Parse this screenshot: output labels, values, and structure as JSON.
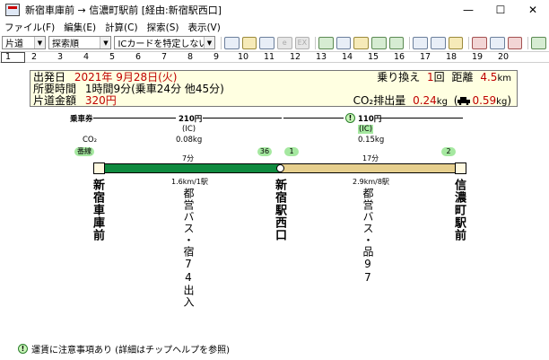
{
  "window": {
    "title": "新宿車庫前 → 信濃町駅前 [経由:新宿駅西口]",
    "minimize": "—",
    "maximize": "☐",
    "close": "✕"
  },
  "menu": [
    "ファイル(F)",
    "編集(E)",
    "計算(C)",
    "探索(S)",
    "表示(V)"
  ],
  "toolbar": {
    "direction_select": "片道",
    "sort_select": "探索順",
    "ic_select": "ICカードを特定しない",
    "disabled_icon_1": "e",
    "disabled_icon_2": "EX"
  },
  "ruler": {
    "numbers": [
      "1",
      "2",
      "3",
      "4",
      "5",
      "6",
      "7",
      "8",
      "9",
      "10",
      "11",
      "12",
      "13",
      "14",
      "15",
      "16",
      "17",
      "18",
      "19",
      "20"
    ],
    "selected": "1"
  },
  "summary": {
    "date_label": "出発日",
    "date_value": "2021年 9月28日(火)",
    "time_label": "所要時間",
    "time_value": "1時間9分(乗車24分 他45分)",
    "fare_label": "片道金額",
    "fare_value": "320円",
    "transfer_label": "乗り換え",
    "transfer_count": "1",
    "transfer_unit": "回",
    "distance_label": "距離",
    "distance_value": "4.5",
    "distance_unit": "km",
    "co2_label": "CO₂排出量",
    "co2_value": "0.24",
    "co2_unit": "kg",
    "co2_car_value": "0.59",
    "co2_car_unit": "kg"
  },
  "route": {
    "ticket_label": "乗車券",
    "co2_label": "CO₂",
    "fare1": "210円",
    "fare1_type": "(IC)",
    "fare1_co2": "0.08kg",
    "fare2": "110円",
    "fare2_type": "(IC)",
    "fare2_co2": "0.15kg",
    "platform_start": "番線",
    "platform_mid1": "36",
    "platform_mid2": "1",
    "platform_end": "2",
    "seg1_time": "7分",
    "seg1_dist": "1.6km/1駅",
    "seg2_time": "17分",
    "seg2_dist": "2.9km/8駅",
    "station1": "新宿車庫前",
    "station2": "新宿駅西口",
    "station3": "信濃町駅前",
    "line1": "都営バス・宿74出入",
    "line2": "都営バス・品97",
    "seg1_color": "#0f8a3f",
    "seg2_color": "#e6cf8e"
  },
  "footer": {
    "icon": "!",
    "text": "運賃に注意事項あり (詳細はチップヘルプを参照)"
  }
}
